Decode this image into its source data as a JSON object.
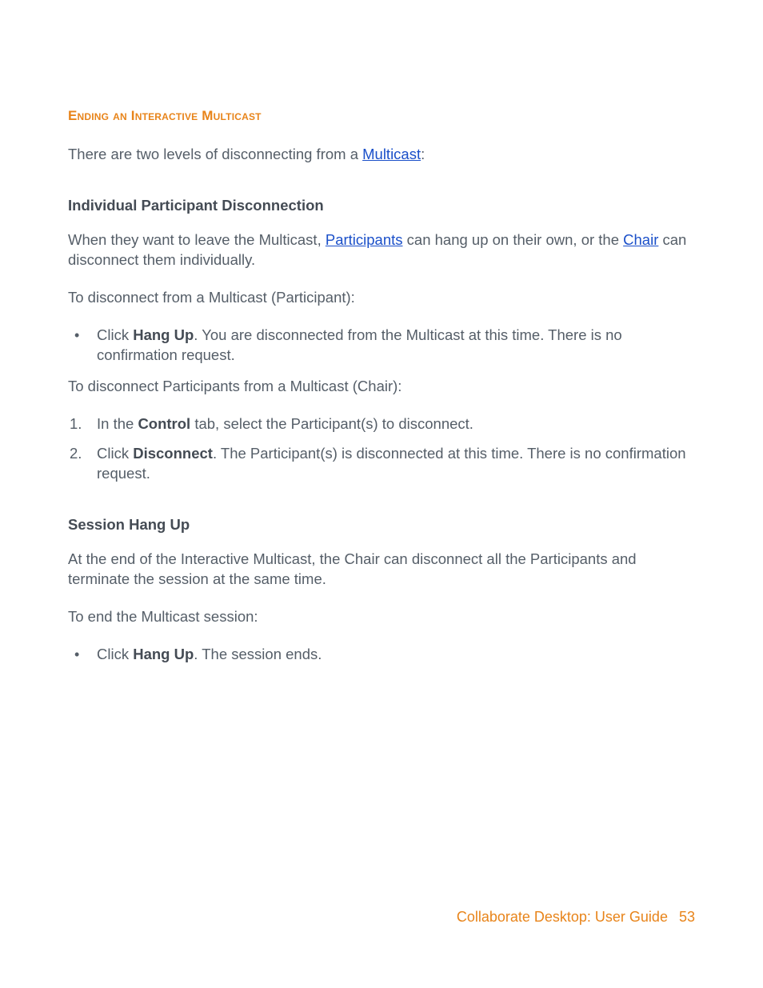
{
  "heading": "Ending an Interactive Multicast",
  "intro_pre": "There are two levels of disconnecting from a ",
  "intro_link": "Multicast",
  "intro_post": ":",
  "sub1": "Individual Participant Disconnection",
  "p1_a": "When they want to leave the Multicast, ",
  "p1_link1": "Participants",
  "p1_b": " can hang up on their own, or the ",
  "p1_link2": "Chair",
  "p1_c": " can disconnect them individually.",
  "p2": "To disconnect from a Multicast (Participant):",
  "bul1_a": "Click ",
  "bul1_strong": "Hang Up",
  "bul1_b": ". You are disconnected from the Multicast at this time. There is no confirmation request.",
  "p3": "To disconnect Participants from a Multicast (Chair):",
  "ol1_a": "In the ",
  "ol1_strong": "Control",
  "ol1_b": " tab, select the Participant(s) to disconnect.",
  "ol2_a": "Click ",
  "ol2_strong": "Disconnect",
  "ol2_b": ". The Participant(s) is disconnected at this time. There is no confirmation request.",
  "sub2": "Session Hang Up",
  "p4": "At the end of the Interactive Multicast, the Chair can disconnect all the Participants and terminate the session at the same time.",
  "p5": "To end the Multicast session:",
  "bul2_a": "Click ",
  "bul2_strong": "Hang Up",
  "bul2_b": ". The session ends.",
  "footer_title": "Collaborate Desktop: User Guide",
  "footer_page": "53"
}
